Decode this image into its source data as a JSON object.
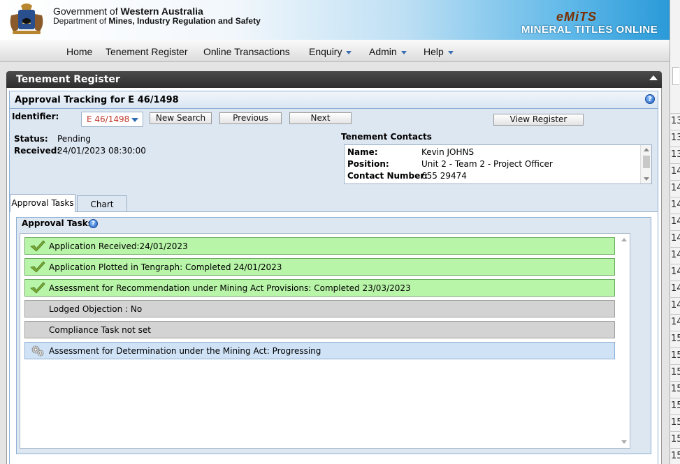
{
  "header": {
    "gov_prefix": "Government of ",
    "gov_name": "Western Australia",
    "dept_prefix": "Department of ",
    "dept_name": "Mines, Industry Regulation and Safety",
    "emits_logo": "eMiTS",
    "mto_logo": "MINERAL TITLES ONLINE"
  },
  "nav": {
    "items": [
      {
        "label": "Home"
      },
      {
        "label": "Tenement Register"
      },
      {
        "label": "Online Transactions"
      },
      {
        "label": "Enquiry"
      },
      {
        "label": "Admin"
      },
      {
        "label": "Help"
      }
    ]
  },
  "panel": {
    "title": "Tenement Register",
    "approval_title": "Approval Tracking for E 46/1498"
  },
  "identifier": {
    "label": "Identifier:",
    "value": "E 46/1498"
  },
  "buttons": {
    "new_search": "New Search",
    "previous": "Previous",
    "next": "Next",
    "view_register": "View Register"
  },
  "status": {
    "status_label": "Status:",
    "status_value": "Pending",
    "received_label": "Received:",
    "received_value": "24/01/2023 08:30:00"
  },
  "contacts": {
    "title": "Tenement Contacts",
    "name_label": "Name:",
    "name_value": "Kevin JOHNS",
    "position_label": "Position:",
    "position_value": "Unit 2 - Team 2 - Project Officer",
    "number_label": "Contact Number:",
    "number_value": "655 29474"
  },
  "tabs": [
    {
      "label": "Approval Tasks",
      "active": true
    },
    {
      "label": "Chart",
      "active": false
    }
  ],
  "tasks_panel": {
    "title": "Approval Tasks",
    "tasks": [
      {
        "text": "Application Received:24/01/2023",
        "state": "done",
        "icon": "checkmark-icon"
      },
      {
        "text": "Application Plotted in Tengraph: Completed 24/01/2023",
        "state": "done",
        "icon": "checkmark-icon"
      },
      {
        "text": "Assessment for Recommendation under Mining Act Provisions: Completed 23/03/2023",
        "state": "done",
        "icon": "checkmark-icon"
      },
      {
        "text": "Lodged Objection : No",
        "state": "not-set",
        "icon": ""
      },
      {
        "text": "Compliance Task not set",
        "state": "not-set",
        "icon": ""
      },
      {
        "text": "Assessment for Determination under the Mining Act: Progressing",
        "state": "progressing",
        "icon": "gears-icon"
      }
    ]
  },
  "right_strip": {
    "numbers": [
      "13",
      "13",
      "13",
      "14",
      "14",
      "14",
      "14",
      "14",
      "14",
      "14",
      "14",
      "14",
      "14",
      "15",
      "15",
      "15",
      "15",
      "15",
      "15",
      "15",
      "15"
    ]
  },
  "colors": {
    "done": "#b8f5a8",
    "not_set": "#d3d3d3",
    "progressing": "#cfe2f6",
    "panel_title": "#3a3a3a",
    "accent": "#2f6db3"
  }
}
